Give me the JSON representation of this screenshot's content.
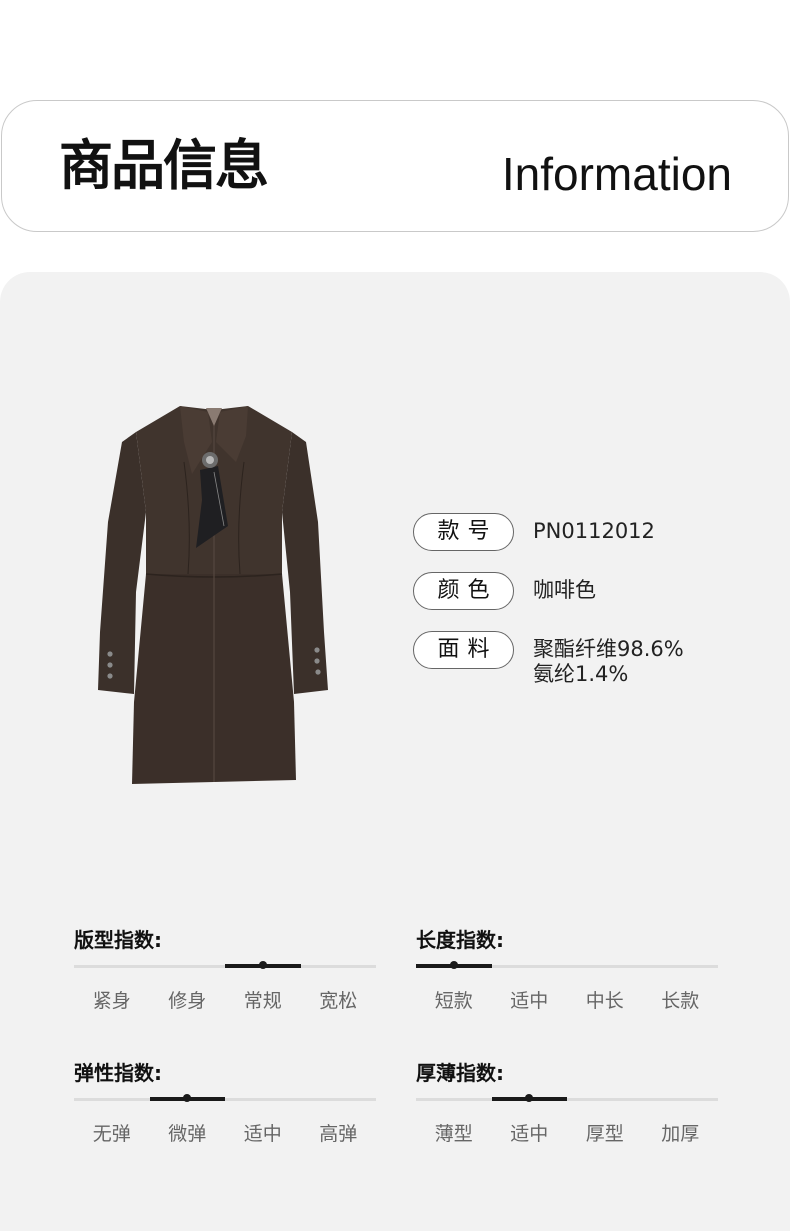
{
  "header": {
    "title_cn": "商品信息",
    "title_en": "Information"
  },
  "product": {
    "image_icon": "dress-image",
    "color_hex": "#3a2e28",
    "attributes": [
      {
        "label": "款号",
        "value": "PN0112012"
      },
      {
        "label": "颜色",
        "value": "咖啡色"
      },
      {
        "label": "面料",
        "value_line1": "聚酯纤维98.6%",
        "value_line2": "氨纶1.4%"
      }
    ]
  },
  "indices": [
    {
      "title": "版型指数:",
      "options": [
        "紧身",
        "修身",
        "常规",
        "宽松"
      ],
      "selected_index": 2
    },
    {
      "title": "长度指数:",
      "options": [
        "短款",
        "适中",
        "中长",
        "长款"
      ],
      "selected_index": 0
    },
    {
      "title": "弹性指数:",
      "options": [
        "无弹",
        "微弹",
        "适中",
        "高弹"
      ],
      "selected_index": 1
    },
    {
      "title": "厚薄指数:",
      "options": [
        "薄型",
        "适中",
        "厚型",
        "加厚"
      ],
      "selected_index": 1
    }
  ]
}
